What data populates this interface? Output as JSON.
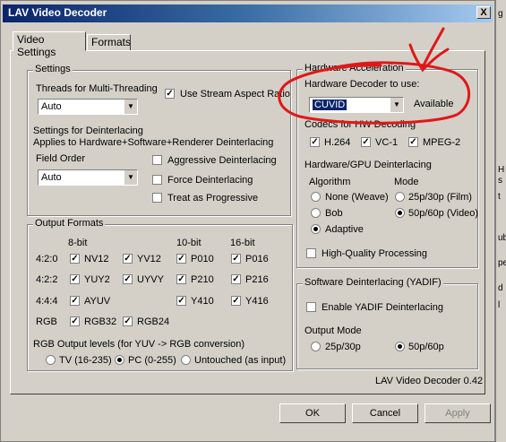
{
  "window": {
    "title": "LAV Video Decoder",
    "close_glyph": "X"
  },
  "background_fragments": [
    "g",
    "H",
    "s",
    "t",
    "ub",
    "pe",
    "d",
    "l"
  ],
  "tabs": [
    {
      "label": "Video Settings",
      "active": true
    },
    {
      "label": "Formats",
      "active": false
    }
  ],
  "settings": {
    "title": "Settings",
    "threads_label": "Threads for Multi-Threading",
    "threads_value": "Auto",
    "stream_aspect_label": "Use Stream Aspect Ratio",
    "stream_aspect_checked": true,
    "deint_title": "Settings for Deinterlacing",
    "deint_subtitle": "Applies to Hardware+Software+Renderer Deinterlacing",
    "field_order_label": "Field Order",
    "field_order_value": "Auto",
    "aggressive_label": "Aggressive Deinterlacing",
    "force_label": "Force Deinterlacing",
    "progressive_label": "Treat as Progressive"
  },
  "output_formats": {
    "title": "Output Formats",
    "col_8bit": "8-bit",
    "col_10bit": "10-bit",
    "col_16bit": "16-bit",
    "rows": [
      {
        "label": "4:2:0",
        "items": [
          "NV12",
          "YV12",
          "P010",
          "P016"
        ]
      },
      {
        "label": "4:2:2",
        "items": [
          "YUY2",
          "UYVY",
          "P210",
          "P216"
        ]
      },
      {
        "label": "4:4:4",
        "items": [
          "AYUV",
          "Y410",
          "Y416"
        ]
      },
      {
        "label": "RGB",
        "items": [
          "RGB32",
          "RGB24"
        ]
      }
    ],
    "levels_label": "RGB Output levels (for YUV -> RGB conversion)",
    "levels_options": [
      "TV (16-235)",
      "PC (0-255)",
      "Untouched (as input)"
    ],
    "levels_selected": "PC (0-255)"
  },
  "hw": {
    "title": "Hardware Acceleration",
    "decoder_label": "Hardware Decoder to use:",
    "decoder_value": "CUVID",
    "decoder_status": "Available",
    "codecs_label": "Codecs for HW Decoding",
    "codecs": [
      "H.264",
      "VC-1",
      "MPEG-2"
    ],
    "deint_label": "Hardware/GPU Deinterlacing",
    "algorithm_label": "Algorithm",
    "algorithms": [
      "None (Weave)",
      "Bob",
      "Adaptive"
    ],
    "algorithm_selected": "Adaptive",
    "mode_label": "Mode",
    "modes": [
      "25p/30p (Film)",
      "50p/60p (Video)"
    ],
    "mode_selected": "50p/60p (Video)",
    "hq_label": "High-Quality Processing"
  },
  "sw": {
    "title": "Software Deinterlacing (YADIF)",
    "enable_label": "Enable YADIF Deinterlacing",
    "mode_label": "Output Mode",
    "modes": [
      "25p/30p",
      "50p/60p"
    ],
    "mode_selected": "50p/60p"
  },
  "version": "LAV Video Decoder 0.42",
  "buttons": {
    "ok": "OK",
    "cancel": "Cancel",
    "apply": "Apply"
  },
  "annotation_color": "#e01818"
}
